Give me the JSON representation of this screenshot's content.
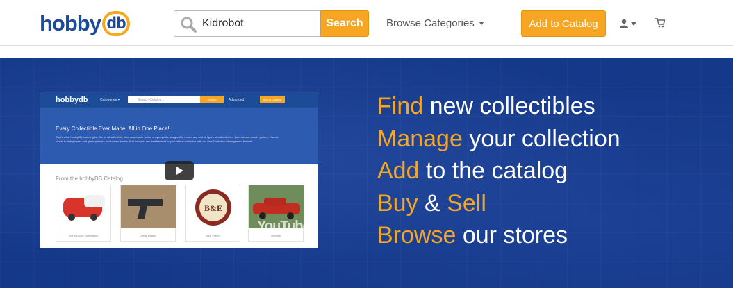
{
  "header": {
    "logo_text": "hobby",
    "logo_mark": "db",
    "search": {
      "value": "Kidrobot",
      "button_label": "Search",
      "icon": "search-icon"
    },
    "browse_label": "Browse Categories",
    "add_button_label": "Add to Catalog",
    "user_icon": "user-icon",
    "cart_icon": "cart-icon"
  },
  "video": {
    "logo_text": "hobbydb",
    "nav_categories": "Categories ▾",
    "search_placeholder": "Search Catalog...",
    "search_button": "Search",
    "advanced": "Advanced",
    "add_button": "Add to Catalog",
    "headline": "Every Collectible Ever Made. All in One Place!",
    "description": "That's what hobbyDB is aiming for. It's an ultra flexible, ultra searchable online encyclopedia designed to record any and all types of collectibles – from diecast cars to guitars, Games charts to teddy bears and gramophones to dinosaur bones. And now you can add them all to your virtual collection with our new Collection Management feature!",
    "from_label": "From the hobbyDB Catalog",
    "cards": [
      {
        "caption": "Hot Van 2nd Generation"
      },
      {
        "caption": "Gerdy Blaster"
      },
      {
        "caption": "B&E Patch"
      },
      {
        "caption": "Gremlin"
      }
    ],
    "youtube_label": "YouTube",
    "play_icon": "play-icon"
  },
  "taglines": [
    {
      "highlight": "Find",
      "rest": " new collectibles"
    },
    {
      "highlight": "Manage",
      "rest": " your collection"
    },
    {
      "highlight": "Add",
      "rest": " to the catalog"
    },
    {
      "highlight": "Buy",
      "rest": " & ",
      "highlight2": "Sell"
    },
    {
      "highlight": "Browse",
      "rest": " our stores"
    }
  ],
  "colors": {
    "brand_blue": "#1c4b98",
    "accent_orange": "#f6a623",
    "hero_blue": "#15398a"
  }
}
